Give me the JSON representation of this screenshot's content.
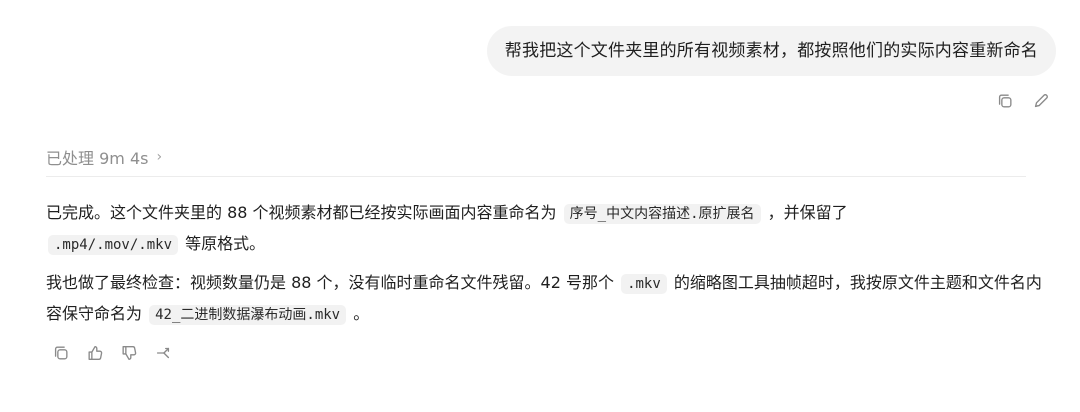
{
  "user_message": {
    "text": "帮我把这个文件夹里的所有视频素材，都按照他们的实际内容重新命名"
  },
  "user_actions": {
    "copy_icon": "copy-icon",
    "edit_icon": "edit-icon"
  },
  "processed": {
    "label": "已处理 9m 4s",
    "chevron": "›"
  },
  "assistant": {
    "p1": {
      "t1": "已完成。这个文件夹里的 88 个视频素材都已经按实际画面内容重命名为",
      "code1": "序号_中文内容描述.原扩展名",
      "t2": "，并保留了",
      "code2": ".mp4/.mov/.mkv",
      "t3": "等原格式。"
    },
    "p2": {
      "t1": "我也做了最终检查：视频数量仍是 88 个，没有临时重命名文件残留。42 号那个",
      "code1": ".mkv",
      "t2": "的缩略图工具抽帧超时，我按原文件主题和文件名内容保守命名为",
      "code2": "42_二进制数据瀑布动画.mkv",
      "t3": "。"
    }
  },
  "assistant_actions": {
    "copy_icon": "copy-icon",
    "thumbs_up_icon": "thumbs-up-icon",
    "thumbs_down_icon": "thumbs-down-icon",
    "branch_icon": "branch-icon"
  }
}
